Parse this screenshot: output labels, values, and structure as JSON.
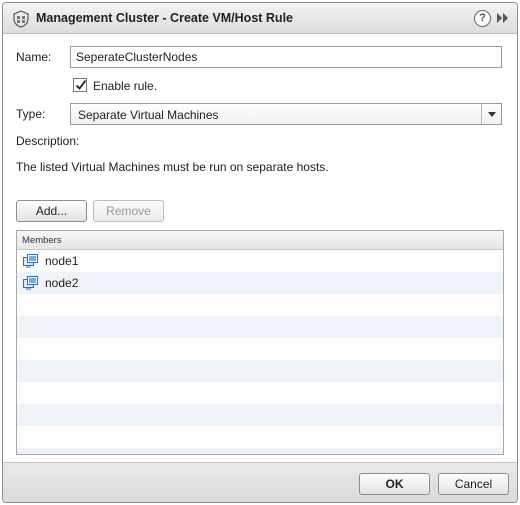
{
  "window": {
    "title": "Management Cluster - Create VM/Host Rule",
    "help_glyph": "?"
  },
  "form": {
    "name_label": "Name:",
    "name_value": "SeperateClusterNodes",
    "enable_label": "Enable rule.",
    "enable_checked": true,
    "type_label": "Type:",
    "type_value": "Separate Virtual Machines",
    "description_label": "Description:",
    "description_text": "The listed Virtual Machines must be run on separate hosts."
  },
  "toolbar": {
    "add_label": "Add...",
    "remove_label": "Remove"
  },
  "members": {
    "header": "Members",
    "items": [
      {
        "label": "node1",
        "icon": "vm-icon"
      },
      {
        "label": "node2",
        "icon": "vm-icon"
      }
    ]
  },
  "footer": {
    "ok_label": "OK",
    "cancel_label": "Cancel"
  },
  "colors": {
    "row_alt": "#eef3fa",
    "vm_icon": "#2f6fb8"
  }
}
